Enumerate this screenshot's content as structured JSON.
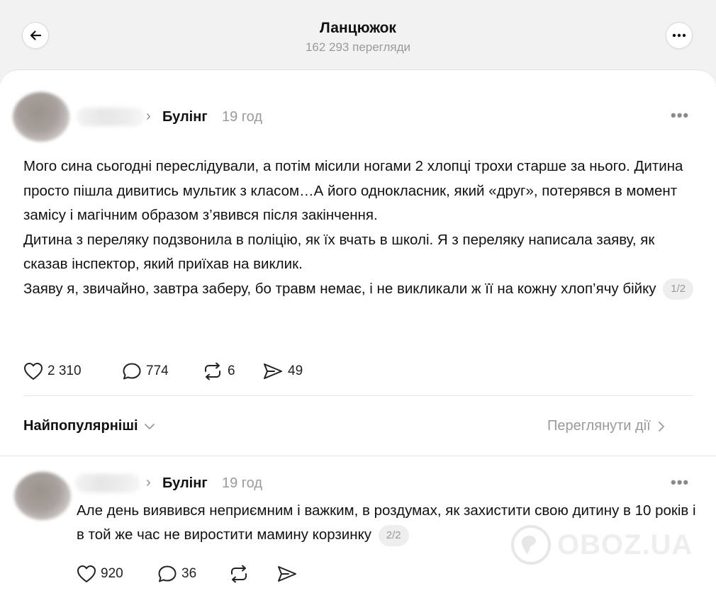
{
  "header": {
    "title": "Ланцюжок",
    "views": "162 293 перегляди",
    "back_icon": "arrow-left-icon",
    "more_icon": "more-horizontal-icon"
  },
  "post": {
    "topic": "Булінг",
    "time": "19 год",
    "paragraphs": [
      "Мого сина сьогодні переслідували, а потім місили ногами 2 хлопці трохи старше за нього. Дитина просто пішла дивитись мультик з класом…А його однокласник, який «друг», потерявся в момент замісу і магічним образом з’явився після закінчення.",
      "Дитина з переляку подзвонила в поліцію, як їх вчать в школі. Я з переляку написала заяву, як сказав інспектор, який приїхав на виклик.",
      "Заяву я, звичайно, завтра заберу, бо травм немає, і не викликали ж її на кожну хлоп’ячу бійку"
    ],
    "page_badge": "1/2",
    "likes": "2 310",
    "comments": "774",
    "reposts": "6",
    "shares": "49"
  },
  "sort": {
    "label": "Найпопулярніші",
    "activity_link": "Переглянути дії"
  },
  "reply": {
    "topic": "Булінг",
    "time": "19 год",
    "text": "Але день виявився неприємним і важким, в роздумах, як захистити свою дитину в 10 років і в той же час не виростити мамину корзинку",
    "page_badge": "2/2",
    "likes": "920",
    "comments": "36"
  },
  "watermark": "OBOZ.UA"
}
